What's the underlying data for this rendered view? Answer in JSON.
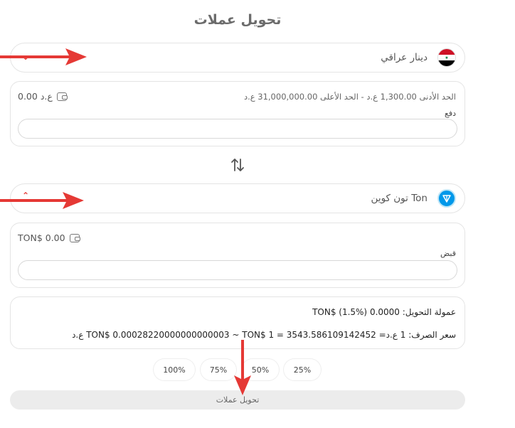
{
  "page": {
    "title": "تحويل عملات"
  },
  "from": {
    "currency_label": "دينار عراقي",
    "flag_icon": "iraq-flag-icon",
    "limits_text": "الحد الأدنى  1,300.00  ع.د    -   الحد الأعلى  31,000,000.00  ع.د",
    "balance": "0.00 ع.د",
    "field_label": "دفع",
    "amount_value": ""
  },
  "swap_icon": "swap-vertical-icon",
  "to": {
    "currency_label": "Ton تون كوين",
    "balance": "TON$ 0.00",
    "field_label": "قبض",
    "amount_value": ""
  },
  "summary": {
    "fee_text": "عمولة التحويل: 0.0000 TON$ (1.5%)",
    "rate_text": "سعر الصرف: 1 ع.د= TON$ 0.00028220000000000003 ~ TON$ 1 = 3543.586109142452 ع.د"
  },
  "percent_buttons": [
    "100%",
    "75%",
    "50%",
    "25%"
  ],
  "submit_label": "تحويل عملات",
  "colors": {
    "accent_red": "#e53935",
    "ton_blue": "#0098ea"
  }
}
